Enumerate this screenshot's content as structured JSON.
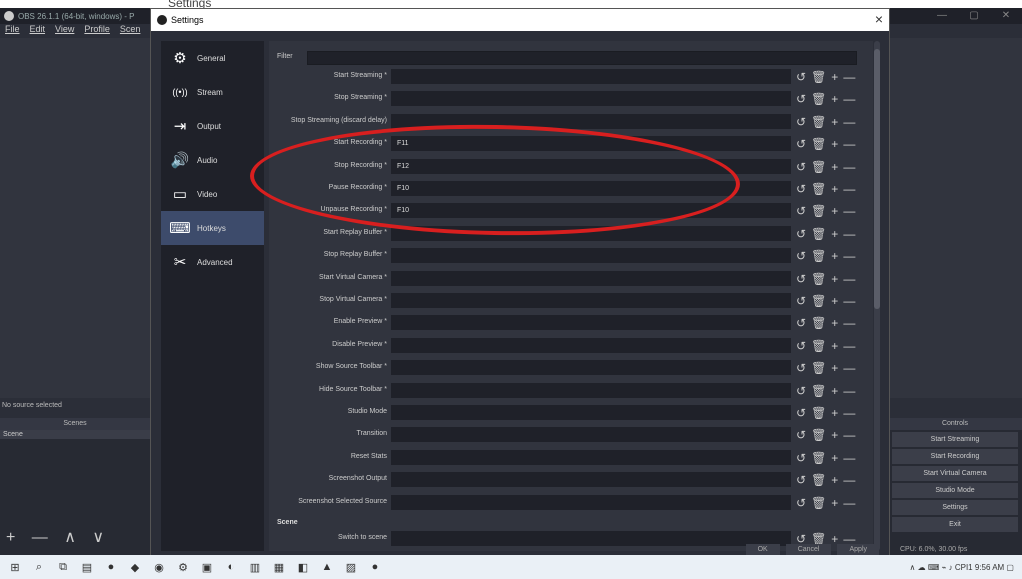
{
  "caption": "Settings",
  "obs": {
    "title": "OBS 26.1.1 (64-bit, windows) - P",
    "menu": [
      "File",
      "Edit",
      "View",
      "Profile",
      "Scen"
    ],
    "status_left": "No source selected",
    "scenes_dock_title": "Scenes",
    "scene_item": "Scene",
    "dock_tools": "+ — ∧ ∨",
    "controls_title": "Controls",
    "controls": [
      "Start Streaming",
      "Start Recording",
      "Start Virtual Camera",
      "Studio Mode",
      "Settings",
      "Exit"
    ],
    "cpu": "CPU: 6.0%, 30.00 fps"
  },
  "dialog": {
    "title": "Settings",
    "close": "×",
    "nav": [
      {
        "label": "General",
        "icon": "⚙"
      },
      {
        "label": "Stream",
        "icon": "((•))"
      },
      {
        "label": "Output",
        "icon": "⇥"
      },
      {
        "label": "Audio",
        "icon": "🔊"
      },
      {
        "label": "Video",
        "icon": "▭"
      },
      {
        "label": "Hotkeys",
        "icon": "⌨"
      },
      {
        "label": "Advanced",
        "icon": "✂"
      }
    ],
    "filter_label": "Filter",
    "hotkeys": [
      {
        "label": "Start Streaming *",
        "value": ""
      },
      {
        "label": "Stop Streaming *",
        "value": ""
      },
      {
        "label": "Stop Streaming (discard delay)",
        "value": ""
      },
      {
        "label": "Start Recording *",
        "value": "F11"
      },
      {
        "label": "Stop Recording *",
        "value": "F12"
      },
      {
        "label": "Pause Recording *",
        "value": "F10"
      },
      {
        "label": "Unpause Recording *",
        "value": "F10"
      },
      {
        "label": "Start Replay Buffer *",
        "value": ""
      },
      {
        "label": "Stop Replay Buffer *",
        "value": ""
      },
      {
        "label": "Start Virtual Camera *",
        "value": ""
      },
      {
        "label": "Stop Virtual Camera *",
        "value": ""
      },
      {
        "label": "Enable Preview *",
        "value": ""
      },
      {
        "label": "Disable Preview *",
        "value": ""
      },
      {
        "label": "Show Source Toolbar *",
        "value": ""
      },
      {
        "label": "Hide Source Toolbar *",
        "value": ""
      },
      {
        "label": "Studio Mode",
        "value": ""
      },
      {
        "label": "Transition",
        "value": ""
      },
      {
        "label": "Reset Stats",
        "value": ""
      },
      {
        "label": "Screenshot Output",
        "value": ""
      },
      {
        "label": "Screenshot Selected Source",
        "value": ""
      }
    ],
    "section_scene": "Scene",
    "scene_hotkey": {
      "label": "Switch to scene",
      "value": ""
    },
    "buttons": [
      "OK",
      "Cancel",
      "Apply"
    ],
    "row_icons": [
      "↺",
      "🗑",
      "+",
      "—"
    ]
  },
  "taskbar": {
    "icons": [
      "⊞",
      "⌕",
      "⧉",
      "▤",
      "●",
      "◆",
      "◉",
      "⚙",
      "▣",
      "◐",
      "▥",
      "▦",
      "◧",
      "▲",
      "▨",
      "●"
    ],
    "tray": "∧  ☁  ⌨  ⌁  ♪  CPI1  9:56 AM  ▢"
  },
  "accent": "#d81f1f"
}
